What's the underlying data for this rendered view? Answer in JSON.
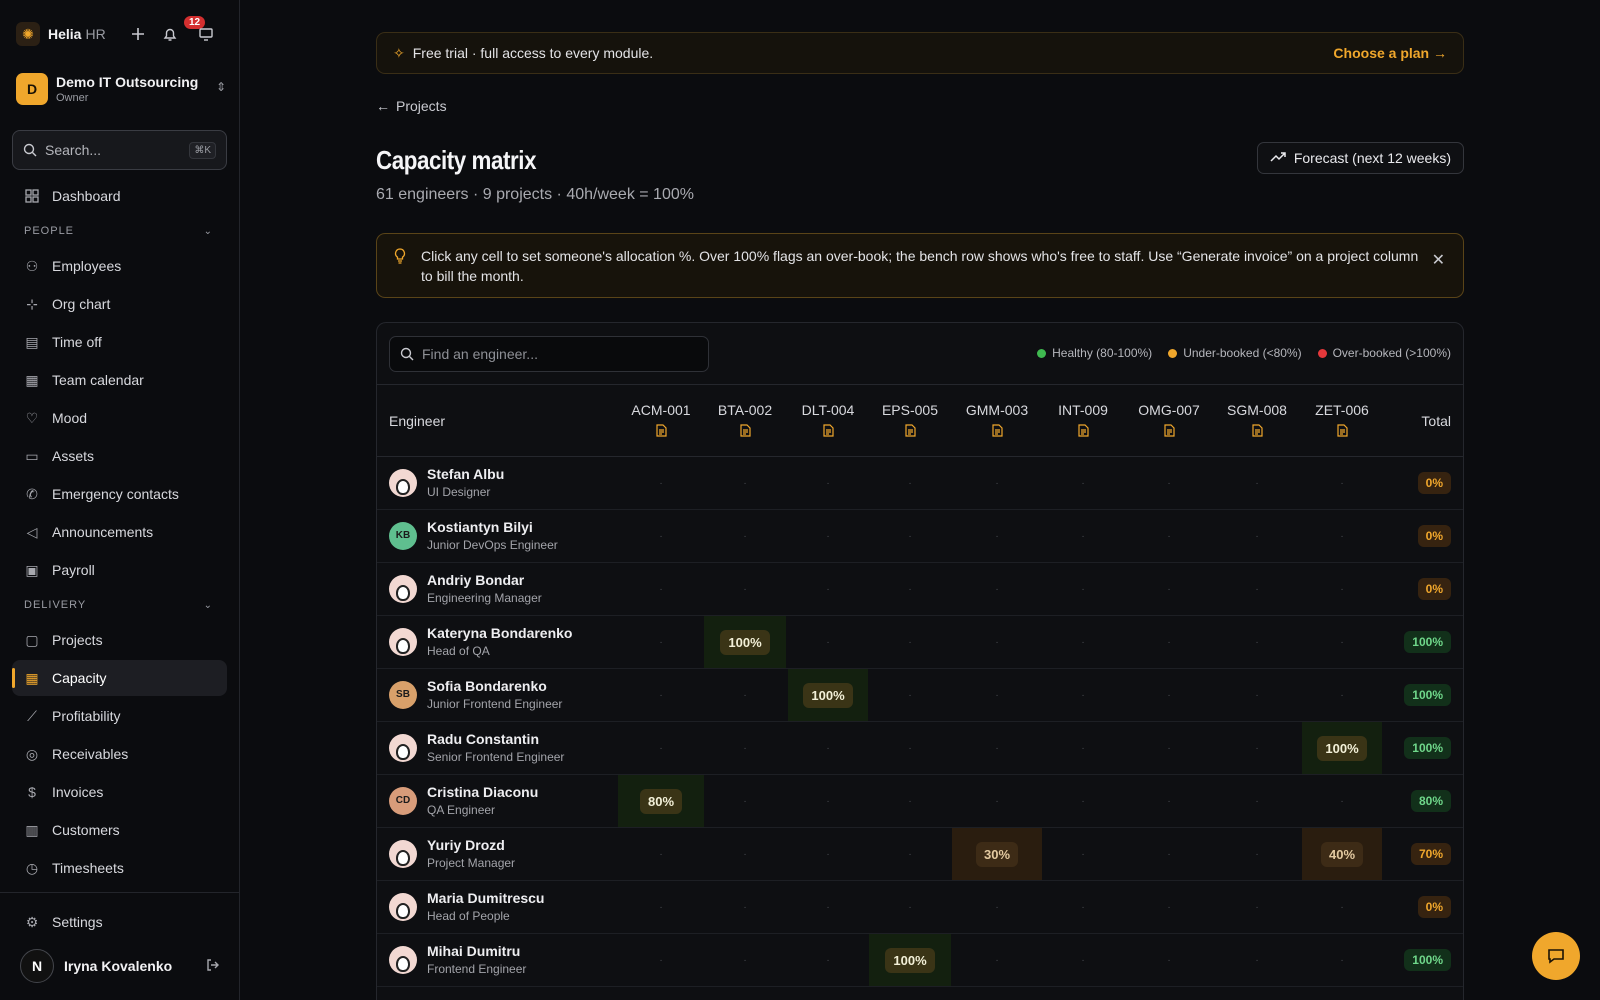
{
  "app": {
    "brand": "Helia",
    "brand_sub": "HR",
    "notifications": "12"
  },
  "org": {
    "initial": "D",
    "name": "Demo IT Outsourcing",
    "role": "Owner"
  },
  "search": {
    "placeholder": "Search...",
    "shortcut": "⌘K"
  },
  "nav": {
    "dashboard": "Dashboard",
    "people_section": "PEOPLE",
    "people": [
      "Employees",
      "Org chart",
      "Time off",
      "Team calendar",
      "Mood",
      "Assets",
      "Emergency contacts",
      "Announcements",
      "Payroll"
    ],
    "delivery_section": "DELIVERY",
    "delivery": [
      "Projects",
      "Capacity",
      "Profitability",
      "Receivables",
      "Invoices",
      "Customers",
      "Timesheets"
    ],
    "settings": "Settings"
  },
  "user": {
    "initial": "N",
    "name": "Iryna Kovalenko"
  },
  "trial": {
    "text": "Free trial · full access to every module.",
    "cta": "Choose a plan →"
  },
  "page": {
    "back": "Projects",
    "title": "Capacity matrix",
    "subtitle": "61 engineers · 9 projects · 40h/week = 100%",
    "forecast": "Forecast (next 12 weeks)"
  },
  "tip": {
    "text": "Click any cell to set someone's allocation %. Over 100% flags an over-book; the bench row shows who's free to staff. Use “Generate invoice” on a project column to bill the month."
  },
  "table": {
    "find_placeholder": "Find an engineer...",
    "legend": [
      {
        "label": "Healthy (80-100%)",
        "color": "#3fb950"
      },
      {
        "label": "Under-booked (<80%)",
        "color": "#f0a72c"
      },
      {
        "label": "Over-booked (>100%)",
        "color": "#e5383b"
      }
    ],
    "col_engineer": "Engineer",
    "col_total": "Total",
    "projects": [
      "ACM-001",
      "BTA-002",
      "DLT-004",
      "EPS-005",
      "GMM-003",
      "INT-009",
      "OMG-007",
      "SGM-008",
      "ZET-006"
    ],
    "rows": [
      {
        "name": "Stefan Albu",
        "role": "UI Designer",
        "avatar": "img",
        "alloc": {},
        "total": "0%",
        "status": "low"
      },
      {
        "name": "Kostiantyn Bilyi",
        "role": "Junior DevOps Engineer",
        "avatar": "KB",
        "avatar_color": "#5fbf8f",
        "alloc": {},
        "total": "0%",
        "status": "low"
      },
      {
        "name": "Andriy Bondar",
        "role": "Engineering Manager",
        "avatar": "img",
        "alloc": {},
        "total": "0%",
        "status": "low"
      },
      {
        "name": "Kateryna Bondarenko",
        "role": "Head of QA",
        "avatar": "img",
        "alloc": {
          "BTA-002": "100%"
        },
        "total": "100%",
        "status": "ok"
      },
      {
        "name": "Sofia Bondarenko",
        "role": "Junior Frontend Engineer",
        "avatar": "SB",
        "avatar_color": "#d8a06a",
        "alloc": {
          "DLT-004": "100%"
        },
        "total": "100%",
        "status": "ok"
      },
      {
        "name": "Radu Constantin",
        "role": "Senior Frontend Engineer",
        "avatar": "img",
        "alloc": {
          "ZET-006": "100%"
        },
        "total": "100%",
        "status": "ok"
      },
      {
        "name": "Cristina Diaconu",
        "role": "QA Engineer",
        "avatar": "CD",
        "avatar_color": "#d89c7a",
        "alloc": {
          "ACM-001": "80%"
        },
        "total": "80%",
        "status": "ok"
      },
      {
        "name": "Yuriy Drozd",
        "role": "Project Manager",
        "avatar": "img",
        "alloc": {
          "GMM-003": "30%",
          "ZET-006": "40%"
        },
        "total": "70%",
        "status": "low"
      },
      {
        "name": "Maria Dumitrescu",
        "role": "Head of People",
        "avatar": "img",
        "alloc": {},
        "total": "0%",
        "status": "low"
      },
      {
        "name": "Mihai Dumitru",
        "role": "Frontend Engineer",
        "avatar": "img",
        "alloc": {
          "EPS-005": "100%"
        },
        "total": "100%",
        "status": "ok"
      }
    ]
  },
  "colors": {
    "accent": "#f0a72c",
    "healthy": "#3fb950",
    "under": "#f0a72c",
    "over": "#e5383b"
  },
  "icons": [
    "sun-logo-icon",
    "plus-icon",
    "bell-icon",
    "monitor-icon",
    "chevrons-updown-icon",
    "search-icon",
    "grid-icon",
    "users-icon",
    "org-chart-icon",
    "calendar-icon",
    "heart-pulse-icon",
    "laptop-icon",
    "phone-icon",
    "megaphone-icon",
    "banknote-icon",
    "briefcase-icon",
    "table-grid-icon",
    "line-chart-icon",
    "coins-icon",
    "dollar-file-icon",
    "building-icon",
    "clock-icon",
    "gear-icon",
    "logout-icon",
    "sparkle-icon",
    "arrow-left-icon",
    "trend-up-icon",
    "bulb-icon",
    "close-icon",
    "document-icon",
    "chat-icon"
  ]
}
